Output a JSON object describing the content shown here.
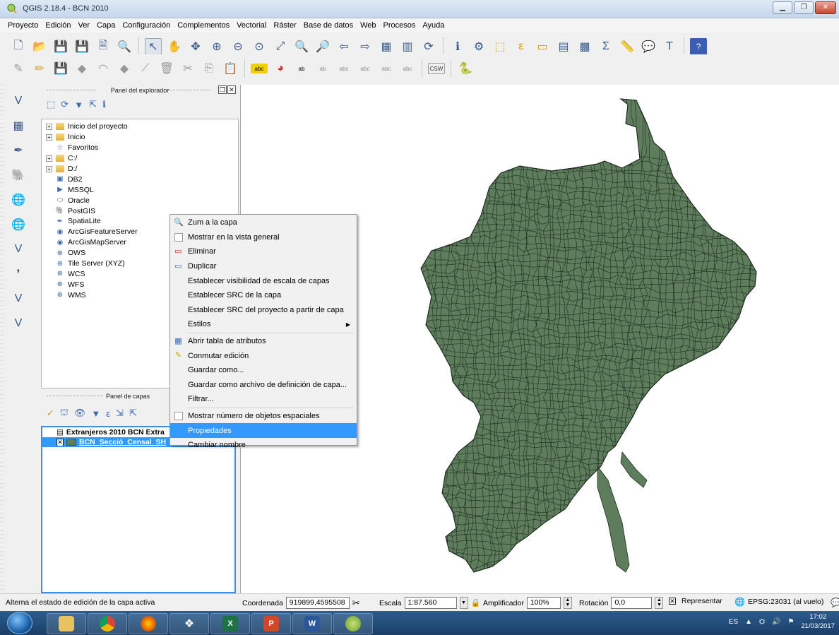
{
  "window": {
    "title": "QGIS 2.18.4 - BCN 2010",
    "controls": [
      "minimize",
      "maximize",
      "close"
    ]
  },
  "menubar": [
    "Proyecto",
    "Edición",
    "Ver",
    "Capa",
    "Configuración",
    "Complementos",
    "Vectorial",
    "Ráster",
    "Base de datos",
    "Web",
    "Procesos",
    "Ayuda"
  ],
  "explorer": {
    "title": "Panel del explorador",
    "items": [
      {
        "label": "Inicio del proyecto",
        "icon": "folder-icon",
        "expandable": true
      },
      {
        "label": "Inicio",
        "icon": "folder-icon",
        "expandable": true
      },
      {
        "label": "Favoritos",
        "icon": "star-icon",
        "expandable": false
      },
      {
        "label": "C:/",
        "icon": "folder-icon",
        "expandable": true
      },
      {
        "label": "D:/",
        "icon": "folder-icon",
        "expandable": true
      },
      {
        "label": "DB2",
        "icon": "db2-icon",
        "expandable": false
      },
      {
        "label": "MSSQL",
        "icon": "mssql-icon",
        "expandable": false
      },
      {
        "label": "Oracle",
        "icon": "oracle-icon",
        "expandable": false
      },
      {
        "label": "PostGIS",
        "icon": "postgis-icon",
        "expandable": false
      },
      {
        "label": "SpatiaLite",
        "icon": "spatialite-icon",
        "expandable": false
      },
      {
        "label": "ArcGisFeatureServer",
        "icon": "arcgis-icon",
        "expandable": false
      },
      {
        "label": "ArcGisMapServer",
        "icon": "arcgis-icon",
        "expandable": false
      },
      {
        "label": "OWS",
        "icon": "globe-icon",
        "expandable": false
      },
      {
        "label": "Tile Server (XYZ)",
        "icon": "globe-icon",
        "expandable": false
      },
      {
        "label": "WCS",
        "icon": "globe-icon",
        "expandable": false
      },
      {
        "label": "WFS",
        "icon": "globe-icon",
        "expandable": false
      },
      {
        "label": "WMS",
        "icon": "globe-icon",
        "expandable": false
      }
    ]
  },
  "layers": {
    "title": "Panel de capas",
    "group": "Extranjeros 2010 BCN Extra",
    "layer": "BCN_Secció_Censal_SH",
    "layer_checked": true,
    "layer_color": "#5d7d5c"
  },
  "context_menu": {
    "items": [
      {
        "label": "Zum a la capa",
        "icon": "zoom-icon"
      },
      {
        "label": "Mostrar en la vista general",
        "icon": "checkbox-icon"
      },
      {
        "label": "Eliminar",
        "icon": "remove-layer-icon"
      },
      {
        "label": "Duplicar",
        "icon": "duplicate-icon"
      },
      {
        "label": "Establecer visibilidad de escala de capas",
        "icon": ""
      },
      {
        "label": "Establecer SRC de la capa",
        "icon": ""
      },
      {
        "label": "Establecer SRC del proyecto a partir de capa",
        "icon": ""
      },
      {
        "label": "Estilos",
        "icon": "",
        "submenu": true
      },
      {
        "label": "Abrir tabla de atributos",
        "icon": "table-icon"
      },
      {
        "label": "Conmutar edición",
        "icon": "pencil-icon"
      },
      {
        "label": "Guardar como...",
        "icon": ""
      },
      {
        "label": "Guardar como archivo de definición de capa...",
        "icon": ""
      },
      {
        "label": "Filtrar...",
        "icon": ""
      },
      {
        "label": "Mostrar número de objetos espaciales",
        "icon": "checkbox-icon"
      },
      {
        "label": "Propiedades",
        "icon": "",
        "highlighted": true
      },
      {
        "label": "Cambiar nombre",
        "icon": ""
      }
    ]
  },
  "statusbar": {
    "message": "Alterna el estado de edición de la capa activa",
    "coord_label": "Coordenada",
    "coord_value": "919899,4595508",
    "scale_label": "Escala",
    "scale_value": "1:87.560",
    "magnifier_label": "Amplificador",
    "magnifier_value": "100%",
    "rotation_label": "Rotación",
    "rotation_value": "0,0",
    "render_label": "Representar",
    "crs": "EPSG:23031 (al vuelo)"
  },
  "taskbar": {
    "language": "ES",
    "time": "17:02",
    "date": "21/03/2017",
    "apps": [
      "file-explorer",
      "chrome",
      "firefox",
      "dropbox",
      "excel",
      "powerpoint",
      "word",
      "qgis"
    ]
  },
  "colors": {
    "map_fill": "#5d7d5c",
    "map_stroke": "#1e2a1e",
    "highlight": "#3399ff"
  }
}
